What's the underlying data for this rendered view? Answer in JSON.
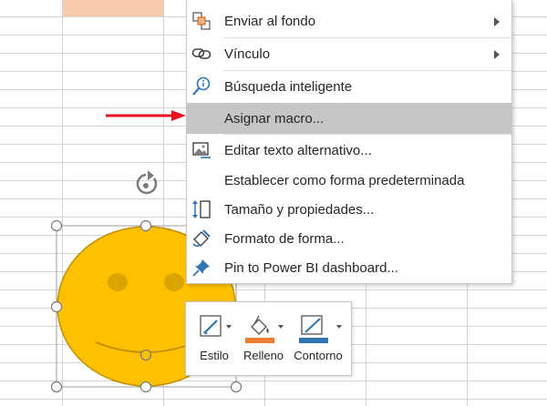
{
  "context_menu": {
    "items": [
      {
        "label": "Enviar al fondo",
        "icon": "send-to-back-icon",
        "submenu": true
      },
      {
        "label": "Vínculo",
        "icon": "link-icon",
        "submenu": true
      },
      {
        "label": "Búsqueda inteligente",
        "icon": "smart-lookup-icon"
      },
      {
        "label": "Asignar macro...",
        "icon": "",
        "highlighted": true
      },
      {
        "label": "Editar texto alternativo...",
        "icon": "alt-text-icon"
      },
      {
        "label": "Establecer como forma predeterminada",
        "icon": ""
      },
      {
        "label": "Tamaño y propiedades...",
        "icon": "size-properties-icon"
      },
      {
        "label": "Formato de forma...",
        "icon": "format-shape-icon"
      },
      {
        "label": "Pin to Power BI dashboard...",
        "icon": "pin-icon"
      }
    ]
  },
  "mini_toolbar": {
    "style_label": "Estilo",
    "fill_label": "Relleno",
    "outline_label": "Contorno"
  },
  "colors": {
    "shape_fill": "#ffc000",
    "shape_outline": "#bf9000",
    "cell_highlight": "#f8cbad",
    "menu_highlight": "#c6c6c6",
    "arrow": "#e81123",
    "fill_swatch": "#ed7d31",
    "outline_swatch": "#2f75b5"
  }
}
